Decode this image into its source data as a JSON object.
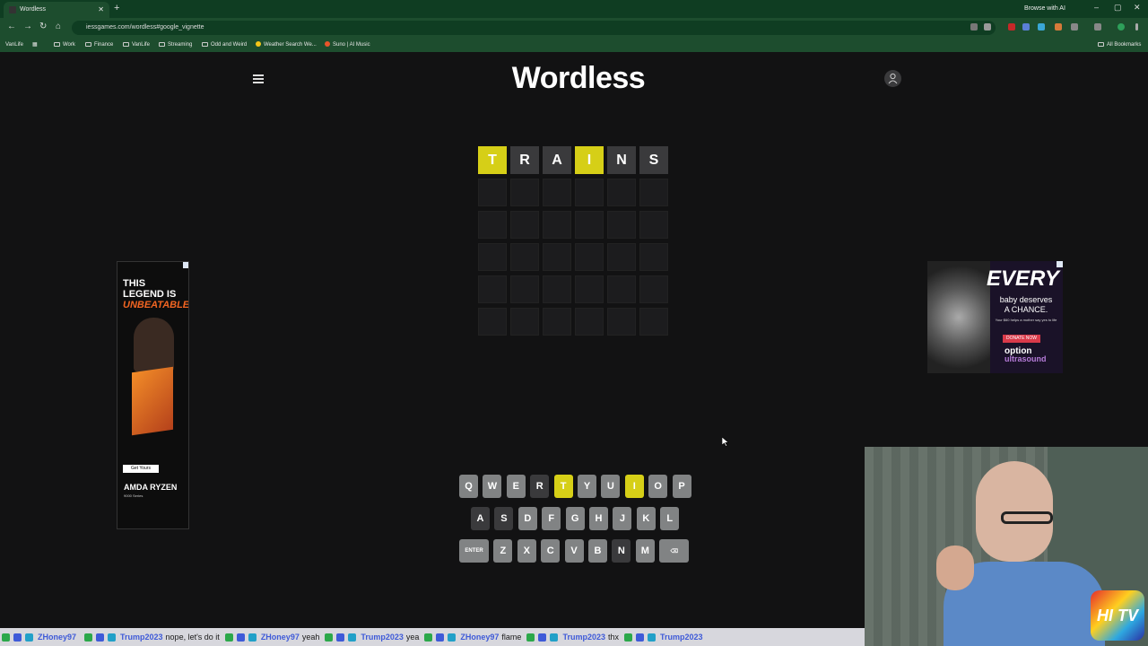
{
  "browser": {
    "tab_title": "Wordless",
    "browse_ai": "Browse with AI",
    "url": "iessgames.com/wordless#google_vignette",
    "bookmarks": [
      "VanLife",
      "Work",
      "Finance",
      "VanLife",
      "Streaming",
      "Odd and Weird",
      "Weather Search We...",
      "Suno | AI Music"
    ],
    "all_bookmarks": "All Bookmarks"
  },
  "game": {
    "title": "Wordless",
    "grid": [
      [
        {
          "letter": "T",
          "state": "yellow"
        },
        {
          "letter": "R",
          "state": "gray"
        },
        {
          "letter": "A",
          "state": "gray"
        },
        {
          "letter": "I",
          "state": "yellow"
        },
        {
          "letter": "N",
          "state": "gray"
        },
        {
          "letter": "S",
          "state": "gray"
        }
      ],
      [
        {
          "letter": "",
          "state": "empty"
        },
        {
          "letter": "",
          "state": "empty"
        },
        {
          "letter": "",
          "state": "empty"
        },
        {
          "letter": "",
          "state": "empty"
        },
        {
          "letter": "",
          "state": "empty"
        },
        {
          "letter": "",
          "state": "empty"
        }
      ],
      [
        {
          "letter": "",
          "state": "empty"
        },
        {
          "letter": "",
          "state": "empty"
        },
        {
          "letter": "",
          "state": "empty"
        },
        {
          "letter": "",
          "state": "empty"
        },
        {
          "letter": "",
          "state": "empty"
        },
        {
          "letter": "",
          "state": "empty"
        }
      ],
      [
        {
          "letter": "",
          "state": "empty"
        },
        {
          "letter": "",
          "state": "empty"
        },
        {
          "letter": "",
          "state": "empty"
        },
        {
          "letter": "",
          "state": "empty"
        },
        {
          "letter": "",
          "state": "empty"
        },
        {
          "letter": "",
          "state": "empty"
        }
      ],
      [
        {
          "letter": "",
          "state": "empty"
        },
        {
          "letter": "",
          "state": "empty"
        },
        {
          "letter": "",
          "state": "empty"
        },
        {
          "letter": "",
          "state": "empty"
        },
        {
          "letter": "",
          "state": "empty"
        },
        {
          "letter": "",
          "state": "empty"
        }
      ],
      [
        {
          "letter": "",
          "state": "empty"
        },
        {
          "letter": "",
          "state": "empty"
        },
        {
          "letter": "",
          "state": "empty"
        },
        {
          "letter": "",
          "state": "empty"
        },
        {
          "letter": "",
          "state": "empty"
        },
        {
          "letter": "",
          "state": "empty"
        }
      ]
    ],
    "keyboard": [
      [
        {
          "k": "Q",
          "s": "unused"
        },
        {
          "k": "W",
          "s": "unused"
        },
        {
          "k": "E",
          "s": "unused"
        },
        {
          "k": "R",
          "s": "absent"
        },
        {
          "k": "T",
          "s": "present"
        },
        {
          "k": "Y",
          "s": "unused"
        },
        {
          "k": "U",
          "s": "unused"
        },
        {
          "k": "I",
          "s": "present"
        },
        {
          "k": "O",
          "s": "unused"
        },
        {
          "k": "P",
          "s": "unused"
        }
      ],
      [
        {
          "k": "A",
          "s": "absent"
        },
        {
          "k": "S",
          "s": "absent"
        },
        {
          "k": "D",
          "s": "unused"
        },
        {
          "k": "F",
          "s": "unused"
        },
        {
          "k": "G",
          "s": "unused"
        },
        {
          "k": "H",
          "s": "unused"
        },
        {
          "k": "J",
          "s": "unused"
        },
        {
          "k": "K",
          "s": "unused"
        },
        {
          "k": "L",
          "s": "unused"
        }
      ],
      [
        {
          "k": "ENTER",
          "s": "unused"
        },
        {
          "k": "Z",
          "s": "unused"
        },
        {
          "k": "X",
          "s": "unused"
        },
        {
          "k": "C",
          "s": "unused"
        },
        {
          "k": "V",
          "s": "unused"
        },
        {
          "k": "B",
          "s": "unused"
        },
        {
          "k": "N",
          "s": "absent"
        },
        {
          "k": "M",
          "s": "unused"
        },
        {
          "k": "⌫",
          "s": "unused"
        }
      ]
    ],
    "colors": {
      "present": "#d6cf17",
      "absent": "#3a3a3c",
      "unused": "#818384"
    }
  },
  "ads": {
    "left": {
      "headline_1": "THIS LEGEND IS",
      "headline_2": "UNBEATABLE",
      "cta": "Get Yours",
      "brand": "AMDA RYZEN",
      "sub": "9000 Series"
    },
    "right": {
      "headline": "EVERY",
      "sub_1": "baby deserves",
      "sub_2": "A CHANCE.",
      "small": "Your $60 helps a mother say yes to life",
      "cta": "DONATE NOW",
      "logo_1": "option",
      "logo_2": "ultrasound"
    }
  },
  "overlay": {
    "logo": "HI TV",
    "chat": [
      {
        "user": "ZHoney97",
        "msg": ""
      },
      {
        "user": "Trump2023",
        "msg": "nope, let's do it"
      },
      {
        "user": "ZHoney97",
        "msg": "yeah"
      },
      {
        "user": "Trump2023",
        "msg": "yea"
      },
      {
        "user": "ZHoney97",
        "msg": "flame"
      },
      {
        "user": "Trump2023",
        "msg": "thx"
      },
      {
        "user": "Trump2023",
        "msg": ""
      }
    ]
  }
}
